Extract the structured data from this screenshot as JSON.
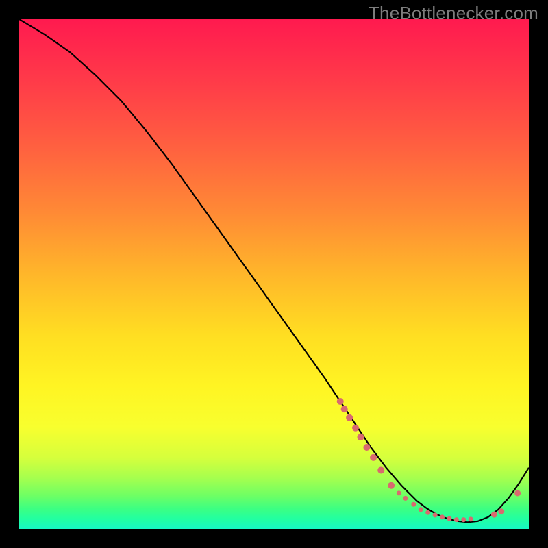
{
  "watermark": "TheBottlenecker.com",
  "colors": {
    "bg_black": "#000000",
    "curve": "#000000",
    "dot_fill": "#d86a6f",
    "gradient_stops": [
      {
        "offset": 0.0,
        "color": "#ff1a4f"
      },
      {
        "offset": 0.12,
        "color": "#ff3a49"
      },
      {
        "offset": 0.25,
        "color": "#ff6040"
      },
      {
        "offset": 0.38,
        "color": "#ff8a35"
      },
      {
        "offset": 0.5,
        "color": "#ffb62a"
      },
      {
        "offset": 0.62,
        "color": "#ffde22"
      },
      {
        "offset": 0.72,
        "color": "#fff423"
      },
      {
        "offset": 0.8,
        "color": "#f8ff2e"
      },
      {
        "offset": 0.86,
        "color": "#d6ff3c"
      },
      {
        "offset": 0.9,
        "color": "#a6ff4e"
      },
      {
        "offset": 0.935,
        "color": "#6eff64"
      },
      {
        "offset": 0.96,
        "color": "#3dff82"
      },
      {
        "offset": 0.98,
        "color": "#22ffa0"
      },
      {
        "offset": 1.0,
        "color": "#17f7c4"
      }
    ]
  },
  "chart_data": {
    "type": "line",
    "title": "",
    "xlabel": "",
    "ylabel": "",
    "xlim": [
      0,
      100
    ],
    "ylim": [
      0,
      100
    ],
    "series": [
      {
        "name": "bottleneck-curve",
        "x": [
          0,
          5,
          10,
          15,
          20,
          25,
          30,
          35,
          40,
          45,
          50,
          55,
          60,
          63,
          66,
          69,
          72,
          75,
          78,
          80,
          82,
          84,
          86,
          88,
          90,
          92,
          94,
          96,
          98,
          100
        ],
        "y": [
          100,
          97,
          93.5,
          89,
          84,
          78,
          71.5,
          64.5,
          57.5,
          50.5,
          43.5,
          36.5,
          29.5,
          25,
          20.5,
          16,
          12,
          8.5,
          5.5,
          4.0,
          2.8,
          2.0,
          1.5,
          1.3,
          1.5,
          2.3,
          3.8,
          6.0,
          8.8,
          12.0
        ]
      }
    ],
    "dots": {
      "name": "highlighted-points",
      "points": [
        {
          "x": 63.0,
          "y": 25.0,
          "r": 5
        },
        {
          "x": 63.8,
          "y": 23.5,
          "r": 5
        },
        {
          "x": 64.8,
          "y": 21.8,
          "r": 5
        },
        {
          "x": 66.0,
          "y": 19.8,
          "r": 5
        },
        {
          "x": 67.0,
          "y": 18.0,
          "r": 5
        },
        {
          "x": 68.2,
          "y": 16.0,
          "r": 5
        },
        {
          "x": 69.5,
          "y": 14.0,
          "r": 5
        },
        {
          "x": 71.0,
          "y": 11.5,
          "r": 5
        },
        {
          "x": 73.0,
          "y": 8.5,
          "r": 5
        },
        {
          "x": 74.5,
          "y": 7.0,
          "r": 3.5
        },
        {
          "x": 75.8,
          "y": 6.0,
          "r": 3.5
        },
        {
          "x": 77.4,
          "y": 4.8,
          "r": 3.5
        },
        {
          "x": 78.8,
          "y": 3.8,
          "r": 3.5
        },
        {
          "x": 80.2,
          "y": 3.2,
          "r": 3.5
        },
        {
          "x": 81.6,
          "y": 2.7,
          "r": 3.5
        },
        {
          "x": 83.0,
          "y": 2.3,
          "r": 3.5
        },
        {
          "x": 84.4,
          "y": 2.0,
          "r": 3.5
        },
        {
          "x": 85.8,
          "y": 1.8,
          "r": 3.5
        },
        {
          "x": 87.2,
          "y": 1.8,
          "r": 3.5
        },
        {
          "x": 88.6,
          "y": 1.9,
          "r": 3.5
        },
        {
          "x": 93.2,
          "y": 2.8,
          "r": 4.5
        },
        {
          "x": 94.6,
          "y": 3.4,
          "r": 4.5
        },
        {
          "x": 97.8,
          "y": 7.0,
          "r": 4.5
        }
      ]
    }
  }
}
